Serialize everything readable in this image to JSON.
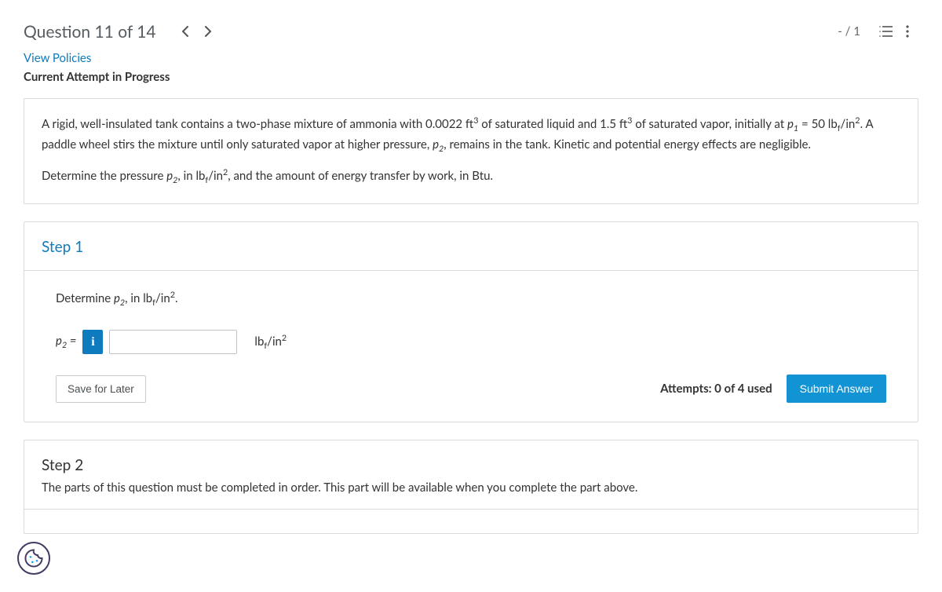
{
  "header": {
    "title": "Question 11 of 14",
    "score": "- / 1"
  },
  "links": {
    "view_policies": "View Policies"
  },
  "status": {
    "attempt": "Current Attempt in Progress"
  },
  "problem": {
    "para1_a": "A rigid, well-insulated tank contains a two-phase mixture of ammonia with 0.0022 ft",
    "para1_b": " of saturated liquid and 1.5 ft",
    "para1_c": " of saturated vapor, initially at ",
    "para1_d": " = 50 lb",
    "para1_e": "/in",
    "para1_f": ".  A paddle wheel stirs the mixture until only saturated vapor at higher pressure, ",
    "para1_g": ", remains in the tank. Kinetic and potential energy effects are negligible.",
    "para2_a": "Determine the pressure ",
    "para2_b": ", in lb",
    "para2_c": "/in",
    "para2_d": ", and the amount of energy transfer by work, in Btu.",
    "exp3": "3",
    "exp2": "2",
    "p1": "p",
    "p1_sub": "1",
    "p2": "p",
    "p2_sub": "2",
    "f_sub": "f"
  },
  "step1": {
    "title": "Step 1",
    "prompt_a": "Determine ",
    "prompt_b": ", in lb",
    "prompt_c": "/in",
    "prompt_d": ".",
    "var": "p",
    "var_sub": "2",
    "eq": " = ",
    "info_icon": "i",
    "unit_a": "lb",
    "unit_b": "/in",
    "f_sub": "f",
    "exp2": "2",
    "save_label": "Save for Later",
    "attempts": "Attempts: 0 of 4 used",
    "submit_label": "Submit Answer",
    "input_value": ""
  },
  "step2": {
    "title": "Step 2",
    "locked_msg": "The parts of this question must be completed in order. This part will be available when you complete the part above."
  }
}
